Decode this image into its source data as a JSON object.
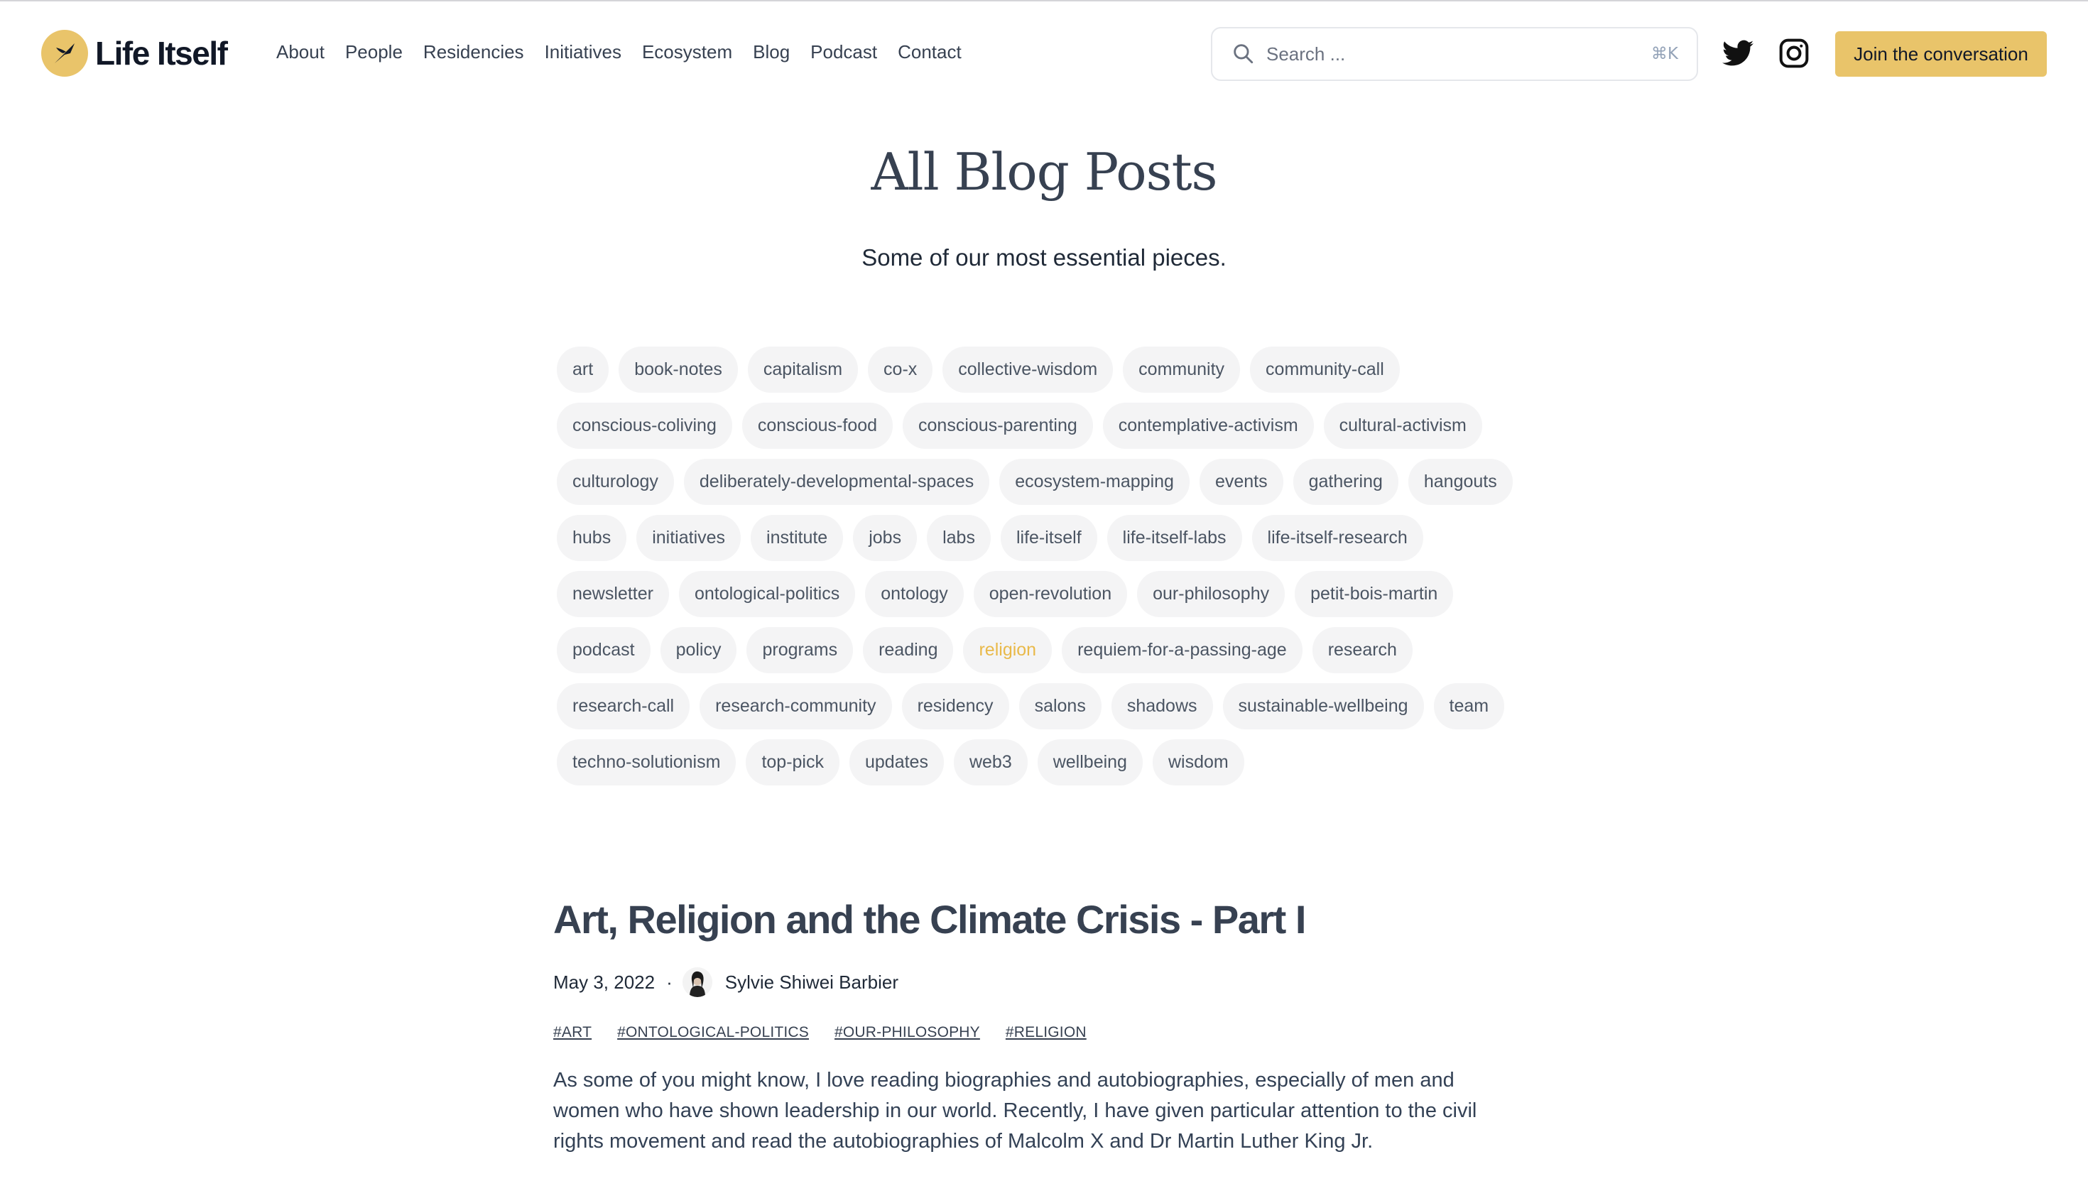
{
  "header": {
    "logo_text": "Life Itself",
    "nav": [
      "About",
      "People",
      "Residencies",
      "Initiatives",
      "Ecosystem",
      "Blog",
      "Podcast",
      "Contact"
    ],
    "search": {
      "placeholder": "Search ...",
      "shortcut": "⌘K"
    },
    "social": [
      "twitter-icon",
      "instagram-icon"
    ],
    "cta_label": "Join the conversation",
    "accent_color": "#e9c46a"
  },
  "main": {
    "title": "All Blog Posts",
    "subtitle": "Some of our most essential pieces.",
    "active_tag": "religion",
    "tags": [
      "art",
      "book-notes",
      "capitalism",
      "co-x",
      "collective-wisdom",
      "community",
      "community-call",
      "conscious-coliving",
      "conscious-food",
      "conscious-parenting",
      "contemplative-activism",
      "cultural-activism",
      "culturology",
      "deliberately-developmental-spaces",
      "ecosystem-mapping",
      "events",
      "gathering",
      "hangouts",
      "hubs",
      "initiatives",
      "institute",
      "jobs",
      "labs",
      "life-itself",
      "life-itself-labs",
      "life-itself-research",
      "newsletter",
      "ontological-politics",
      "ontology",
      "open-revolution",
      "our-philosophy",
      "petit-bois-martin",
      "podcast",
      "policy",
      "programs",
      "reading",
      "religion",
      "requiem-for-a-passing-age",
      "research",
      "research-call",
      "research-community",
      "residency",
      "salons",
      "shadows",
      "sustainable-wellbeing",
      "team",
      "techno-solutionism",
      "top-pick",
      "updates",
      "web3",
      "wellbeing",
      "wisdom"
    ]
  },
  "post": {
    "title": "Art, Religion and the Climate Crisis - Part I",
    "date": "May 3, 2022",
    "separator": "·",
    "author": "Sylvie Shiwei Barbier",
    "tags": [
      "#ART",
      "#ONTOLOGICAL-POLITICS",
      "#OUR-PHILOSOPHY",
      "#RELIGION"
    ],
    "excerpt": "As some of you might know, I love reading  biographies and  autobiographies, especially of men and women who have shown leadership in our world. Recently, I have given particular attention to the civil rights movement and read the autobiographies of Malcolm X and Dr Martin Luther King Jr."
  }
}
